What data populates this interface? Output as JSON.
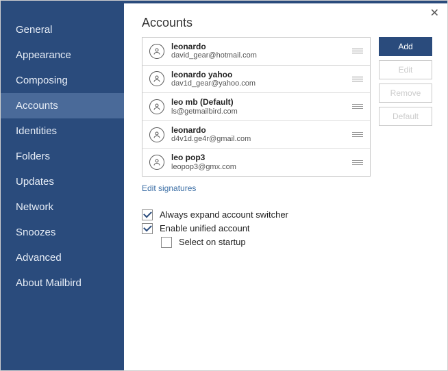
{
  "sidebar": {
    "items": [
      {
        "label": "General"
      },
      {
        "label": "Appearance"
      },
      {
        "label": "Composing"
      },
      {
        "label": "Accounts"
      },
      {
        "label": "Identities"
      },
      {
        "label": "Folders"
      },
      {
        "label": "Updates"
      },
      {
        "label": "Network"
      },
      {
        "label": "Snoozes"
      },
      {
        "label": "Advanced"
      },
      {
        "label": "About Mailbird"
      }
    ],
    "activeIndex": 3
  },
  "page": {
    "title": "Accounts",
    "edit_signatures": "Edit signatures"
  },
  "accounts": [
    {
      "name": "leonardo",
      "email": "david_gear@hotmail.com"
    },
    {
      "name": "leonardo yahoo",
      "email": "dav1d_gear@yahoo.com"
    },
    {
      "name": "leo mb (Default)",
      "email": "ls@getmailbird.com"
    },
    {
      "name": "leonardo",
      "email": "d4v1d.ge4r@gmail.com"
    },
    {
      "name": "leo pop3",
      "email": "leopop3@gmx.com"
    }
  ],
  "buttons": {
    "add": "Add",
    "edit": "Edit",
    "remove": "Remove",
    "default": "Default"
  },
  "options": {
    "expand": "Always expand account switcher",
    "unified": "Enable unified account",
    "startup": "Select on startup"
  }
}
